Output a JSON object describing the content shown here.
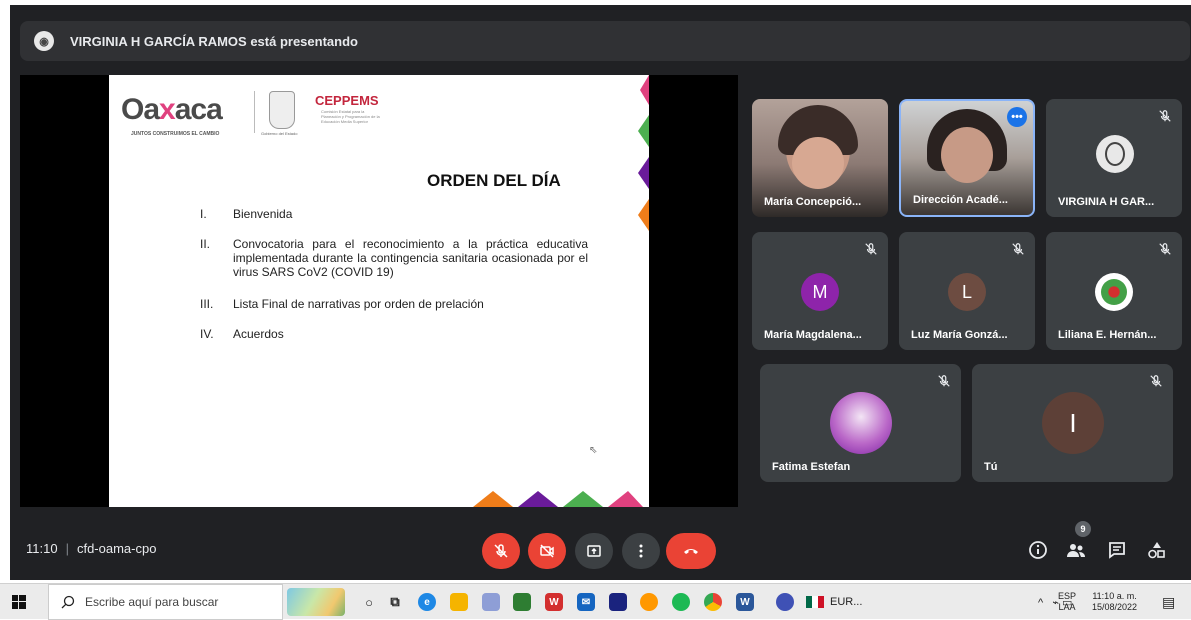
{
  "presenting_bar": {
    "text": "VIRGINIA H GARCÍA RAMOS está presentando"
  },
  "slide": {
    "logo_left": "Oa",
    "logo_x": "x",
    "logo_right": "aca",
    "logo_tagline": "JUNTOS CONSTRUIMOS EL CAMBIO",
    "crest_caption": "Gobierno del Estado",
    "ceppems": "CEPPEMS",
    "ceppems_sub": "Comisión Estatal para la Planeación y Programación de la Educación Media Superior",
    "title": "ORDEN DEL DÍA",
    "items": [
      {
        "num": "I.",
        "text": "Bienvenida"
      },
      {
        "num": "II.",
        "text": "Convocatoria para el reconocimiento a la práctica educativa implementada durante la contingencia sanitaria ocasionada por el virus SARS CoV2 (COVID 19)"
      },
      {
        "num": "III.",
        "text": "Lista Final de narrativas por orden de prelación"
      },
      {
        "num": "IV.",
        "text": "Acuerdos"
      }
    ]
  },
  "participants": [
    {
      "name": "María Concepció...",
      "kind": "video",
      "muted": false
    },
    {
      "name": "Dirección Acadé...",
      "kind": "video",
      "muted": false,
      "active": true
    },
    {
      "name": "VIRGINIA H GAR...",
      "kind": "avatar-photo",
      "muted": true
    },
    {
      "name": "María Magdalena...",
      "kind": "initial",
      "initial": "M",
      "color": "#8e24aa",
      "muted": true
    },
    {
      "name": "Luz María Gonzá...",
      "kind": "initial",
      "initial": "L",
      "color": "#6d4c41",
      "muted": true
    },
    {
      "name": "Liliana E. Hernán...",
      "kind": "logo-photo",
      "muted": true
    },
    {
      "name": "Fatima Estefan",
      "kind": "avatar-photo",
      "muted": true
    },
    {
      "name": "Tú",
      "kind": "initial",
      "initial": "I",
      "color": "#5d4037",
      "muted": true
    }
  ],
  "bottom_bar": {
    "time": "11:10",
    "separator": "|",
    "meeting_code": "cfd-oama-cpo",
    "people_count": "9"
  },
  "taskbar": {
    "search_placeholder": "Escribe aquí para buscar",
    "lang_top": "ESP",
    "lang_bottom": "LAA",
    "time": "11:10 a. m.",
    "date": "15/08/2022",
    "currency": "EUR..."
  },
  "colors": {
    "meet_bg": "#202124",
    "tile_bg": "#3c4043",
    "danger": "#ea4335",
    "control": "#3c4043"
  }
}
